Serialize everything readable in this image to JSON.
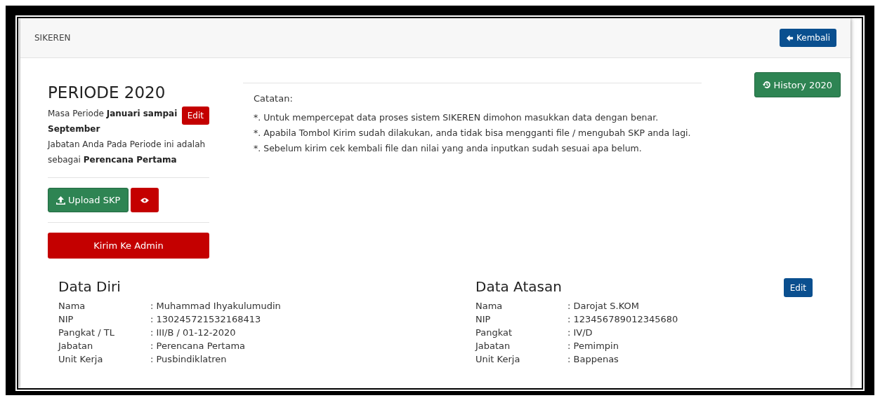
{
  "navbar": {
    "brand": "SIKEREN",
    "back_button": "Kembali"
  },
  "periode": {
    "title": "PERIODE 2020",
    "masa": "Masa Periode **Januari sampai September**",
    "edit_button": "Edit",
    "jabatan": "Jabatan Anda Pada Periode ini adalah sebagai **Perencana Pertama**",
    "upload_button": "Upload SKP",
    "kirim_button": "Kirim Ke Admin"
  },
  "catatan": {
    "title": "Catatan:",
    "items": [
      "*. Untuk mempercepat data proses sistem SIKEREN dimohon masukkan data dengan benar.",
      "*. Apabila Tombol Kirim sudah dilakukan, anda tidak bisa mengganti file / mengubah SKP anda lagi.",
      "*. Sebelum kirim cek kembali file dan nilai yang anda inputkan sudah sesuai apa belum."
    ]
  },
  "history_button": "History 2020",
  "data_diri": {
    "title": "Data Diri",
    "rows": [
      {
        "label": "Nama",
        "value": ": Muhammad Ihyakulumudin"
      },
      {
        "label": "NIP",
        "value": ": 130245721532168413"
      },
      {
        "label": "Pangkat / TL",
        "value": ": III/B / 01-12-2020"
      },
      {
        "label": "Jabatan",
        "value": ": Perencana Pertama"
      },
      {
        "label": "Unit Kerja",
        "value": ": Pusbindiklatren"
      }
    ]
  },
  "data_atasan": {
    "title": "Data Atasan",
    "edit_button": "Edit",
    "rows": [
      {
        "label": "Nama",
        "value": ": Darojat S.KOM"
      },
      {
        "label": "NIP",
        "value": ": 123456789012345680"
      },
      {
        "label": "Pangkat",
        "value": ": IV/D"
      },
      {
        "label": "Jabatan",
        "value": ": Pemimpin"
      },
      {
        "label": "Unit Kerja",
        "value": ": Bappenas"
      }
    ]
  }
}
